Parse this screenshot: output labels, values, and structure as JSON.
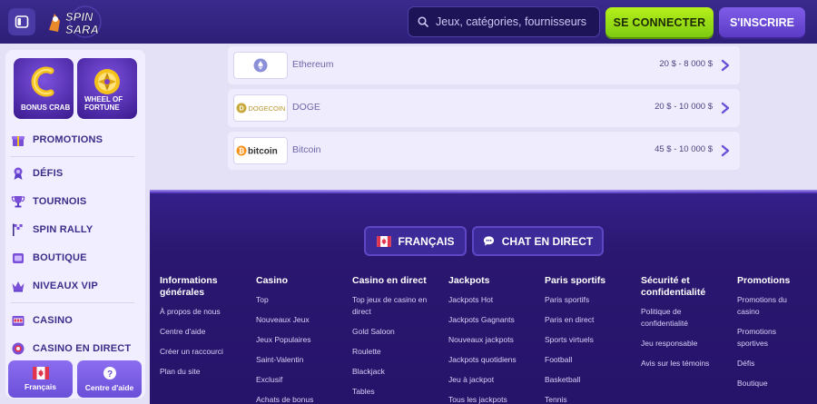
{
  "header": {
    "search_placeholder": "Jeux, catégories, fournisseurs",
    "login_label": "SE CONNECTER",
    "signup_label": "S'INSCRIRE",
    "logo_text": "SPIN SARA"
  },
  "sidebar": {
    "promos": [
      {
        "label": "BONUS CRAB",
        "icon": "crab-coin-icon"
      },
      {
        "label": "WHEEL OF FORTUNE",
        "icon": "wheel-icon"
      }
    ],
    "items": [
      {
        "label": "PROMOTIONS",
        "icon": "gift-icon"
      },
      {
        "label": "DÉFIS",
        "icon": "medal-icon"
      },
      {
        "label": "TOURNOIS",
        "icon": "trophy-icon"
      },
      {
        "label": "SPIN RALLY",
        "icon": "flag-icon"
      },
      {
        "label": "BOUTIQUE",
        "icon": "shop-icon"
      },
      {
        "label": "NIVEAUX VIP",
        "icon": "crown-icon"
      },
      {
        "label": "CASINO",
        "icon": "slot-icon"
      },
      {
        "label": "CASINO EN DIRECT",
        "icon": "chip-icon"
      }
    ],
    "language_label": "Français",
    "help_label": "Centre d'aide"
  },
  "payments": [
    {
      "logo": "ethereum",
      "name": "Ethereum",
      "limit": "20 $ - 8 000 $"
    },
    {
      "logo": "DOGECOIN",
      "name": "DOGE",
      "limit": "20 $ - 10 000 $"
    },
    {
      "logo": "bitcoin",
      "name": "Bitcoin",
      "limit": "45 $ - 10 000 $"
    }
  ],
  "footer": {
    "language_label": "FRANÇAIS",
    "chat_label": "CHAT EN DIRECT",
    "columns": [
      {
        "title": "Informations générales",
        "links": [
          "À propos de nous",
          "Centre d'aide",
          "Créer un raccourci",
          "Plan du site"
        ]
      },
      {
        "title": "Casino",
        "links": [
          "Top",
          "Nouveaux Jeux",
          "Jeux Populaires",
          "Saint-Valentin",
          "Exclusif",
          "Achats de bonus"
        ]
      },
      {
        "title": "Casino en direct",
        "links": [
          "Top jeux de casino en direct",
          "Gold Saloon",
          "Roulette",
          "Blackjack",
          "Tables"
        ]
      },
      {
        "title": "Jackpots",
        "links": [
          "Jackpots Hot",
          "Jackpots Gagnants",
          "Nouveaux jackpots",
          "Jackpots quotidiens",
          "Jeu à jackpot",
          "Tous les jackpots"
        ]
      },
      {
        "title": "Paris sportifs",
        "links": [
          "Paris sportifs",
          "Paris en direct",
          "Sports virtuels",
          "Football",
          "Basketball",
          "Tennis"
        ]
      },
      {
        "title": "Sécurité et confidentialité",
        "links": [
          "Politique de confidentialité",
          "Jeu responsable",
          "Avis sur les témoins"
        ]
      },
      {
        "title": "Promotions",
        "links": [
          "Promotions du casino",
          "Promotions sportives",
          "Défis",
          "Boutique"
        ]
      }
    ]
  },
  "colors": {
    "brand": "#2d1f78",
    "accent_green": "#9be016",
    "accent_purple": "#6a4fd8",
    "nav_text": "#3b2d8a"
  }
}
